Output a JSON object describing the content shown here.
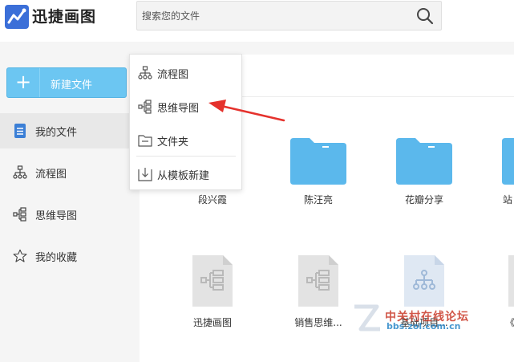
{
  "app": {
    "title": "迅捷画图"
  },
  "search": {
    "placeholder": "搜索您的文件"
  },
  "sidebar": {
    "new_label": "新建文件",
    "items": [
      {
        "label": "我的文件",
        "icon": "document-icon",
        "active": true
      },
      {
        "label": "流程图",
        "icon": "flowchart-icon"
      },
      {
        "label": "思维导图",
        "icon": "mindmap-icon"
      },
      {
        "label": "我的收藏",
        "icon": "star-icon"
      }
    ]
  },
  "dropdown": {
    "items": [
      {
        "label": "流程图",
        "icon": "flowchart-icon"
      },
      {
        "label": "思维导图",
        "icon": "mindmap-icon"
      },
      {
        "label": "文件夹",
        "icon": "folder-icon"
      },
      {
        "label": "从模板新建",
        "icon": "template-import-icon"
      }
    ]
  },
  "folders": [
    {
      "name": "段兴霞"
    },
    {
      "name": "陈汪亮"
    },
    {
      "name": "花瓣分享"
    },
    {
      "name": "站"
    }
  ],
  "files": [
    {
      "name": "迅捷画图",
      "icon": "mindmap-file-icon"
    },
    {
      "name": "销售思维...",
      "icon": "mindmap-file-icon"
    },
    {
      "name": "基础项目...",
      "icon": "flowchart-file-icon"
    },
    {
      "name": "《",
      "icon": "file-icon"
    }
  ],
  "watermark": {
    "text": "中关村在线论坛",
    "url": "bbs.zol.com.cn"
  },
  "colors": {
    "accent": "#6cc6f2",
    "folder": "#5bb8ec",
    "arrow": "#e5322d"
  }
}
